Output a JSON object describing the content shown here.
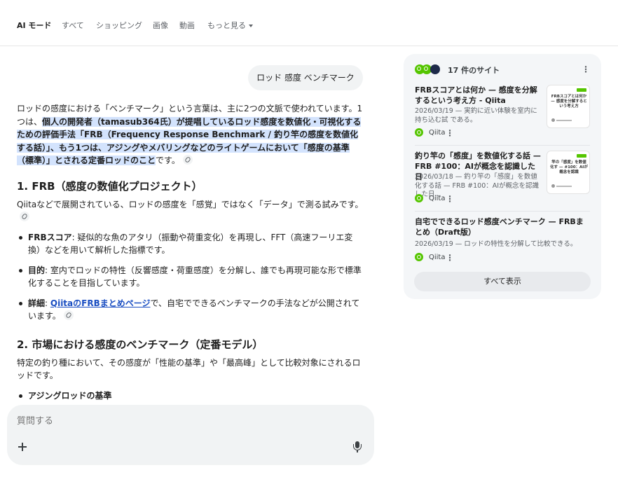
{
  "nav": {
    "tabs": [
      "AI モード",
      "すべて",
      "ショッピング",
      "画像",
      "動画",
      "もっと見る"
    ]
  },
  "query": "ロッド 感度 ベンチマーク",
  "answer": {
    "intro_plain1": "ロッドの感度における「ベンチマーク」という言葉は、主に2つの文脈で使われています。1つは、",
    "intro_hl": "個人の開発者（tamasub364氏）が提唱しているロッド感度を数値化・可視化するための評価手法「FRB（Frequency Response Benchmark / 釣り竿の感度を数値化する話）」、もう1つは、アジングやメバリングなどのライトゲームにおいて「感度の基準（標準）」とされる定番ロッドのこと",
    "intro_plain2": "です。",
    "section1": {
      "heading": "1. FRB（感度の数値化プロジェクト）",
      "desc": "Qiitaなどで展開されている、ロッドの感度を「感覚」ではなく「データ」で測る試みです。",
      "bullets": [
        {
          "term": "FRBスコア",
          "text": ": 疑似的な魚のアタリ（振動や荷重変化）を再現し、FFT（高速フーリエ変換）などを用いて解析した指標です。"
        },
        {
          "term": "目的",
          "text": ": 室内でロッドの特性（反響感度・荷重感度）を分解し、誰でも再現可能な形で標準化することを目指しています。"
        },
        {
          "term": "詳細",
          "link": "QiitaのFRBまとめページ",
          "text": "で、自宅でできるベンチマークの手法などが公開されています。"
        }
      ]
    },
    "section2": {
      "heading": "2. 市場における感度のベンチマーク（定番モデル）",
      "desc": "特定の釣り種において、その感度が「性能の基準」や「最高峰」として比較対象にされるロッドです。",
      "bullets": [
        {
          "term": "アジングロッドの基準"
        }
      ]
    }
  },
  "sidebar": {
    "count_label": "17 件のサイト",
    "cards": [
      {
        "title": "FRBスコアとは何か — 感度を分解するという考え方 - Qiita",
        "snippet": "2026/03/19 — 実釣に近い体験を室内に持ち込む試 である。",
        "source": "Qiita",
        "thumb_text": "FRBスコアとは何か — 感度を分解するという考え方",
        "thumb_icon": "thumb-author-dot"
      },
      {
        "title": "釣り竿の「感度」を数値化する話 — FRB #100：AIが概念を認識した日",
        "snippet": "2026/03/18 — 釣り竿の「感度」を数値化する話 — FRB #100：AIが概念を認識した日...",
        "source": "Qiita",
        "thumb_text": "竿の「感度」を数値化す — #100：AIが概念を認識",
        "thumb_icon": "thumb-author-dot"
      },
      {
        "title": "自宅でできるロッド感度ベンチマーク — FRBまとめ（Draft版）",
        "snippet": "2026/03/19 — ロッドの特性を分解して比較できる。",
        "source": "Qiita"
      }
    ],
    "show_all": "すべて表示"
  },
  "input": {
    "placeholder": "質問する"
  },
  "colors": {
    "highlight": "#d3e3fd",
    "link": "#1a4ec2",
    "qiita_green": "#55c500"
  }
}
